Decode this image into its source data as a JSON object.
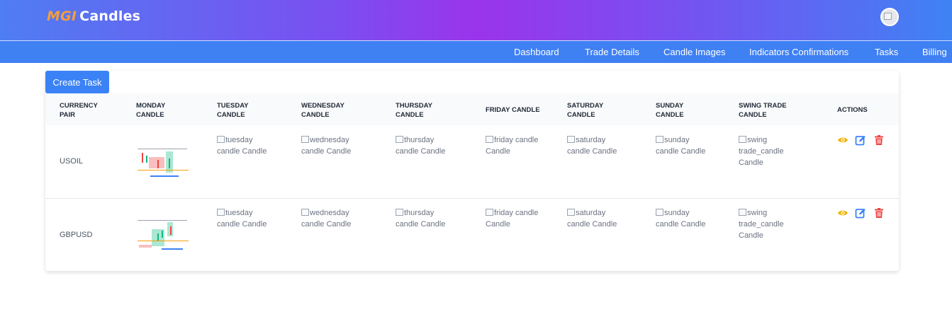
{
  "brand": {
    "part1": "MGI",
    "part2": "Candles"
  },
  "nav": {
    "items": [
      "Dashboard",
      "Trade Details",
      "Candle Images",
      "Indicators Confirmations",
      "Tasks",
      "Billing"
    ]
  },
  "toolbar": {
    "create_label": "Create Task"
  },
  "table": {
    "headers": {
      "currency_pair": [
        "CURRENCY",
        "PAIR"
      ],
      "monday": [
        "MONDAY",
        "CANDLE"
      ],
      "tuesday": [
        "TUESDAY",
        "CANDLE"
      ],
      "wednesday": [
        "WEDNESDAY",
        "CANDLE"
      ],
      "thursday": [
        "THURSDAY",
        "CANDLE"
      ],
      "friday": [
        "FRIDAY CANDLE",
        ""
      ],
      "saturday": [
        "SATURDAY",
        "CANDLE"
      ],
      "sunday": [
        "SUNDAY",
        "CANDLE"
      ],
      "swing": [
        "SWING TRADE",
        "CANDLE"
      ],
      "actions": [
        "ACTIONS",
        ""
      ]
    },
    "rows": [
      {
        "pair": "USOIL",
        "tuesday": [
          "tuesday",
          "candle Candle"
        ],
        "wednesday": [
          "wednesday",
          "candle Candle"
        ],
        "thursday": [
          "thursday",
          "candle Candle"
        ],
        "friday": [
          "friday candle",
          "Candle"
        ],
        "saturday": [
          "saturday",
          "candle Candle"
        ],
        "sunday": [
          "sunday",
          "candle Candle"
        ],
        "swing": [
          "swing",
          "trade_candle",
          "Candle"
        ]
      },
      {
        "pair": "GBPUSD",
        "tuesday": [
          "tuesday",
          "candle Candle"
        ],
        "wednesday": [
          "wednesday",
          "candle Candle"
        ],
        "thursday": [
          "thursday",
          "candle Candle"
        ],
        "friday": [
          "friday candle",
          "Candle"
        ],
        "saturday": [
          "saturday",
          "candle Candle"
        ],
        "sunday": [
          "sunday",
          "candle Candle"
        ],
        "swing": [
          "swing",
          "trade_candle",
          "Candle"
        ]
      }
    ]
  },
  "icons": {
    "view": "eye-icon",
    "edit": "edit-icon",
    "delete": "trash-icon"
  },
  "colors": {
    "brand_accent": "#f59e3b",
    "nav_bg": "#3f80f3",
    "primary_button": "#3b82f6",
    "view_icon": "#eab308",
    "edit_icon": "#3b82f6",
    "delete_icon": "#ef4444"
  }
}
